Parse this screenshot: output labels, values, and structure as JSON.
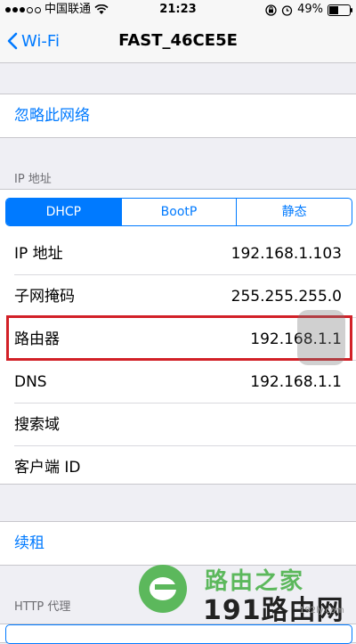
{
  "status_bar": {
    "carrier": "中国联通",
    "time": "21:23",
    "battery": "49%",
    "battery_level": 0.49
  },
  "nav": {
    "back_label": "Wi-Fi",
    "title": "FAST_46CE5E"
  },
  "forget": {
    "label": "忽略此网络"
  },
  "ip_section": {
    "header": "IP 地址",
    "segments": [
      "DHCP",
      "BootP",
      "静态"
    ],
    "selected_segment": "DHCP",
    "rows": [
      {
        "label": "IP 地址",
        "value": "192.168.1.103"
      },
      {
        "label": "子网掩码",
        "value": "255.255.255.0"
      },
      {
        "label": "路由器",
        "value": "192.168.1.1"
      },
      {
        "label": "DNS",
        "value": "192.168.1.1"
      },
      {
        "label": "搜索域",
        "value": ""
      },
      {
        "label": "客户端 ID",
        "value": ""
      }
    ]
  },
  "renew": {
    "label": "续租"
  },
  "http_proxy": {
    "header": "HTTP 代理"
  },
  "watermark": {
    "line1": "路由之家",
    "line2": "191路由网",
    "line3": "192ly.com"
  },
  "colors": {
    "accent": "#007aff",
    "highlight_box": "#d22027",
    "background": "#efeff4"
  }
}
